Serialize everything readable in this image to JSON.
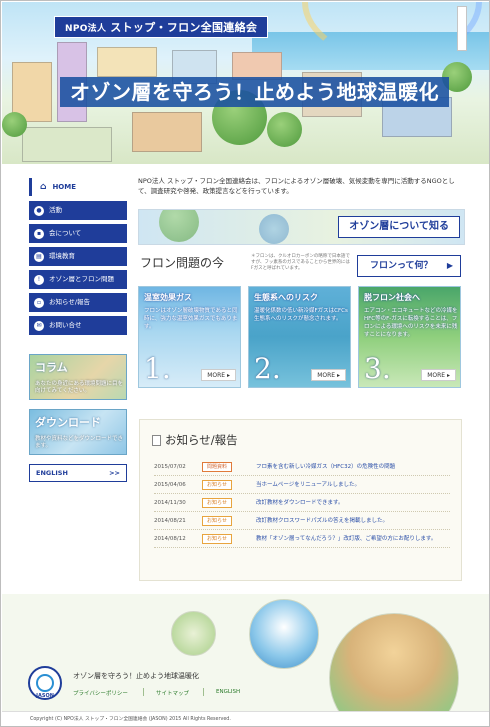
{
  "hero": {
    "org_prefix": "NPO法人",
    "org_name": "ストップ・フロン全国連絡会",
    "slogan": "オゾン層を守ろう！止めよう地球温暖化"
  },
  "sidebar": {
    "home": "HOME",
    "items": [
      {
        "label": "活動",
        "icon": "activity-icon"
      },
      {
        "label": "会について",
        "icon": "about-icon"
      },
      {
        "label": "環境教育",
        "icon": "book-icon"
      },
      {
        "label": "オゾン層とフロン問題",
        "icon": "info-icon"
      },
      {
        "label": "お知らせ/報告",
        "icon": "notice-icon"
      },
      {
        "label": "お問い合せ",
        "icon": "mail-icon"
      }
    ],
    "column_banner": {
      "title": "コラム",
      "desc": "あなたの身近にある環境問題に目を向けてみてください。"
    },
    "download_banner": {
      "title": "ダウンロード",
      "desc": "教材や資料などをダウンロードできます。"
    },
    "english": "ENGLISH",
    "english_arrow": ">>"
  },
  "main": {
    "intro": "NPO法人 ストップ・フロン全国連絡会は、フロンによるオゾン層破壊、気候変動を専門に活動するNGOとして、調査研究や啓発、政策提言などを行っています。",
    "ozone_banner_label": "オゾン層について知る",
    "section_title": "フロン問題の今",
    "section_note": "＊フロンは、クルオロカーボンの略称で日本語ですが、フッ素系のガスであることから世界的にはFガスと呼ばれています。",
    "furon_btn": "フロンって何？",
    "cards": [
      {
        "title": "温室効果ガス",
        "text": "フロンはオゾン層破壊物質であると同時に、強力な温室効果ガスでもあります。",
        "num": "1.",
        "more": "MORE ▸"
      },
      {
        "title": "生態系へのリスク",
        "text": "温暖化係数の低い新冷媒FガスはCFCs生態系へのリスクが懸念されます。",
        "num": "2.",
        "more": "MORE ▸"
      },
      {
        "title": "脱フロン社会へ",
        "text": "エアコン・エコキュートなどの冷媒をHFC等のF-ガスに転換することは、フロンによる環境へのリスクを未来に残すことになります。",
        "num": "3.",
        "more": "MORE ▸"
      }
    ]
  },
  "news": {
    "title": "お知らせ/報告",
    "rows": [
      {
        "date": "2015/07/02",
        "tag": "問題資料",
        "text": "フロ素を含む新しい冷媒ガス（HFC32）の危険性の問題"
      },
      {
        "date": "2015/04/06",
        "tag": "お知らせ",
        "text": "当ホームページをリニューアルしました。"
      },
      {
        "date": "2014/11/30",
        "tag": "お知らせ",
        "text": "改訂教材をダウンロードできます。"
      },
      {
        "date": "2014/08/21",
        "tag": "お知らせ",
        "text": "改訂教材クロスワードパズルの答えを掲載しました。"
      },
      {
        "date": "2014/08/12",
        "tag": "お知らせ",
        "text": "教材「オゾン層ってなんだろう？」改訂版、ご希望の方にお配りします。"
      }
    ]
  },
  "footer": {
    "logo_text": "JASON",
    "slogan": "オゾン層を守ろう！止めよう地球温暖化",
    "links": [
      "プライバシーポリシー",
      "サイトマップ",
      "ENGLISH"
    ],
    "copyright": "Copyright (C) NPO法人 ストップ・フロン全国連絡会 (JASON) 2015 All Rights Reserved."
  },
  "colors": {
    "primary": "#1f3d9a",
    "accent": "#e8a43e",
    "link": "#2a4ea8"
  }
}
